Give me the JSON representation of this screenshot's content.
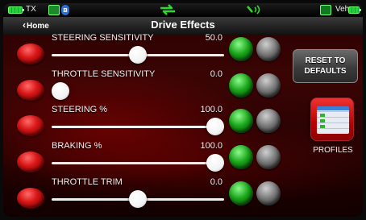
{
  "status_bar": {
    "tx_label": "TX",
    "veh_label": "Veh",
    "icons": [
      "battery-icon",
      "phone-icon",
      "bluetooth-icon",
      "sync-arrows-icon",
      "signal-icon",
      "car-icon",
      "battery-icon"
    ],
    "bluetooth_glyph": "ʙ"
  },
  "header": {
    "back_label": "Home",
    "title": "Drive Effects"
  },
  "controls": [
    {
      "label": "STEERING SENSITIVITY",
      "value": "50.0",
      "level": 0.5,
      "track_visible": true
    },
    {
      "label": "THROTTLE SENSITIVITY",
      "value": "0.0",
      "level": 0.0,
      "track_visible": false
    },
    {
      "label": "STEERING %",
      "value": "100.0",
      "level": 1.0,
      "track_visible": true
    },
    {
      "label": "BRAKING %",
      "value": "100.0",
      "level": 1.0,
      "track_visible": true
    },
    {
      "label": "THROTTLE TRIM",
      "value": "0.0",
      "level": 0.5,
      "track_visible": true
    }
  ],
  "side_panel": {
    "reset_line1": "RESET TO",
    "reset_line2": "DEFAULTS",
    "profiles_label": "PROFILES"
  },
  "colors": {
    "accent_red": "#d81616",
    "accent_green": "#1aa51a",
    "background": "#2a0000"
  }
}
